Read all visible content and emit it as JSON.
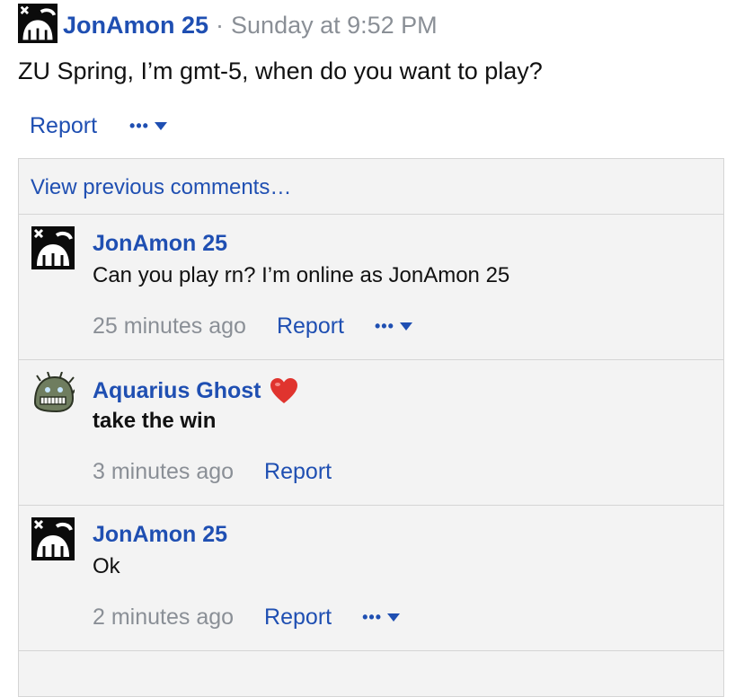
{
  "post": {
    "author": "JonAmon 25",
    "separator": "·",
    "timestamp": "Sunday at 9:52 PM",
    "text": "ZU Spring, I’m gmt-5, when do you want to play?",
    "report_label": "Report",
    "menu_dots": "•••"
  },
  "comments_section": {
    "view_previous": "View previous comments…",
    "comments": [
      {
        "author": "JonAmon 25",
        "text": "Can you play rn? I’m online as JonAmon 25",
        "time": "25 minutes ago",
        "report_label": "Report",
        "menu_dots": "•••"
      },
      {
        "author": "Aquarius Ghost",
        "badge": "heart-emoji",
        "text": "take the win",
        "time": "3 minutes ago",
        "report_label": "Report"
      },
      {
        "author": "JonAmon 25",
        "text": "Ok",
        "time": "2 minutes ago",
        "report_label": "Report",
        "menu_dots": "•••"
      }
    ]
  },
  "colors": {
    "link": "#1f4fb2",
    "muted": "#8a8f96",
    "panel_bg": "#f3f3f3",
    "border": "#d5d5d5"
  }
}
